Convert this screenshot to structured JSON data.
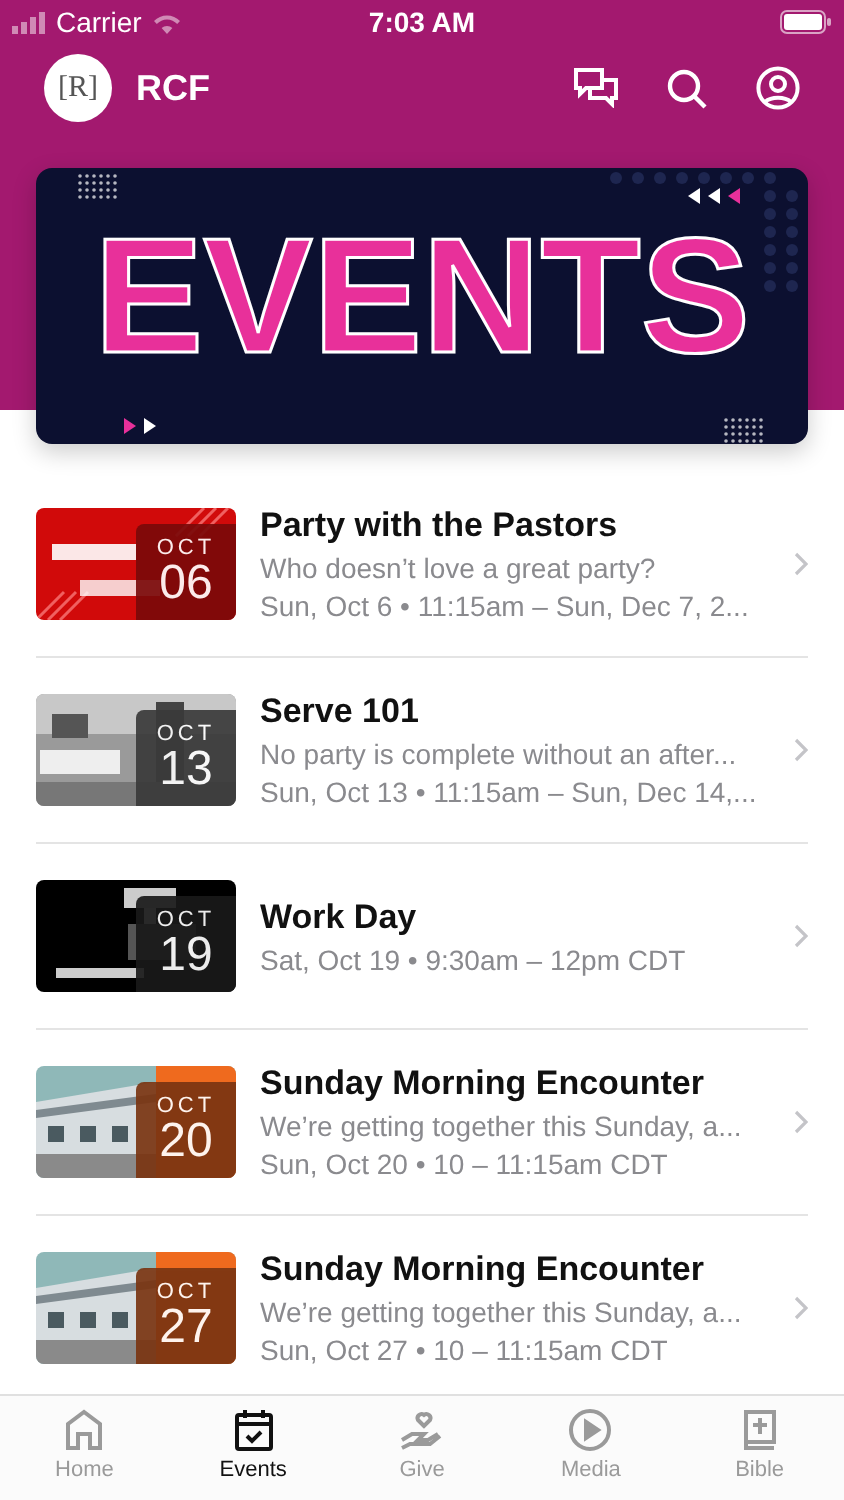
{
  "status_bar": {
    "carrier": "Carrier",
    "time": "7:03 AM"
  },
  "header": {
    "logo": "[R]",
    "title": "RCF"
  },
  "banner": {
    "title": "EVENTS"
  },
  "events": [
    {
      "month": "OCT",
      "day": "06",
      "color": "#7a0a0a",
      "title": "Party with the Pastors",
      "description": "Who doesn’t love a great party?",
      "when": "Sun, Oct 6 • 11:15am – Sun, Dec 7, 2..."
    },
    {
      "month": "OCT",
      "day": "13",
      "color": "#3a3a3a",
      "title": "Serve 101",
      "description": "No party is complete without an after...",
      "when": "Sun, Oct 13 • 11:15am – Sun, Dec 14,..."
    },
    {
      "month": "OCT",
      "day": "19",
      "color": "#1a1a1a",
      "title": "Work Day",
      "when": "Sat, Oct 19 • 9:30am – 12pm CDT"
    },
    {
      "month": "OCT",
      "day": "20",
      "color": "#7a3512",
      "title": "Sunday Morning Encounter",
      "description": "We’re getting together this Sunday, a...",
      "when": "Sun, Oct 20 • 10 – 11:15am CDT"
    },
    {
      "month": "OCT",
      "day": "27",
      "color": "#7a3512",
      "title": "Sunday Morning Encounter",
      "description": "We’re getting together this Sunday, a...",
      "when": "Sun, Oct 27 • 10 – 11:15am CDT"
    }
  ],
  "tabs": [
    {
      "kind": "home",
      "label": "Home",
      "selected": false
    },
    {
      "kind": "events",
      "label": "Events",
      "selected": true
    },
    {
      "kind": "give",
      "label": "Give",
      "selected": false
    },
    {
      "kind": "media",
      "label": "Media",
      "selected": false
    },
    {
      "kind": "bible",
      "label": "Bible",
      "selected": false
    }
  ]
}
